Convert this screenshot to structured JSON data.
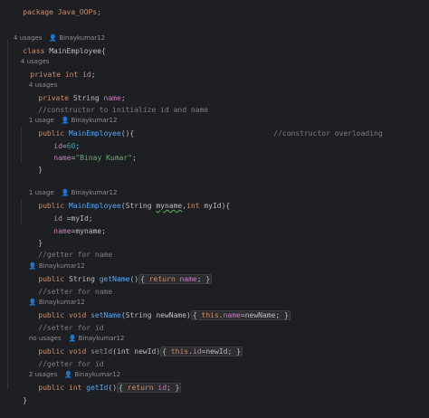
{
  "editor": {
    "package_line": "package Java_OOPs;",
    "hints": {
      "class_usages": "4 usages",
      "class_author": "Binaykumar12",
      "id_usages": "4 usages",
      "name_usages": "4 usages",
      "ctor1_usages": "1 usage",
      "ctor1_author": "Binaykumar12",
      "ctor2_usages": "1 usage",
      "ctor2_author": "Binaykumar12",
      "getname_author": "Binaykumar12",
      "setname_author": "Binaykumar12",
      "setid_usages": "no usages",
      "setid_author": "Binaykumar12",
      "getid_usages": "2 usages",
      "getid_author": "Binaykumar12"
    },
    "code": {
      "class_kw": "class",
      "class_name": "MainEmployee{",
      "private_kw": "private",
      "int_kw": "int",
      "id_field": "id",
      "semicolon": ";",
      "string_type": "String",
      "name_field": "name",
      "comment_ctor": "//constructor to initialize id and name",
      "public_kw": "public",
      "ctor_name": "MainEmployee",
      "ctor1_sig_end": "(){",
      "comment_overload": "//constructor overloading",
      "assign_id_lhs": "id",
      "assign_eq": "=",
      "id_value": "60",
      "assign_name_lhs": "name",
      "name_value": "\"Binay Kumar\"",
      "close_brace": "}",
      "ctor2_params_open": "(String ",
      "ctor2_param_myname": "myname",
      "ctor2_params_mid": ",",
      "ctor2_params_end": " myId){",
      "ctor2_body1_lhs": "id",
      "ctor2_body1_rhs": " =myId;",
      "ctor2_body2_lhs": "name",
      "ctor2_body2_rhs": "=myname;",
      "comment_getter_name": "//getter for name",
      "getname_fn": "getName",
      "parens": "()",
      "return_kw": "return",
      "comment_setter_name": "//setter for name",
      "void_kw": "void",
      "setname_fn": "setName",
      "setname_params": "(String newName)",
      "this_kw": "this",
      "setname_rhs": "=newName;",
      "comment_setter_id": "//setter for id",
      "setid_fn": "setId",
      "setid_params": "(int newId)",
      "setid_rhs": "=newId;",
      "comment_getter_id": "//getter for id",
      "getid_fn": "getId",
      "final_brace": "}"
    }
  }
}
